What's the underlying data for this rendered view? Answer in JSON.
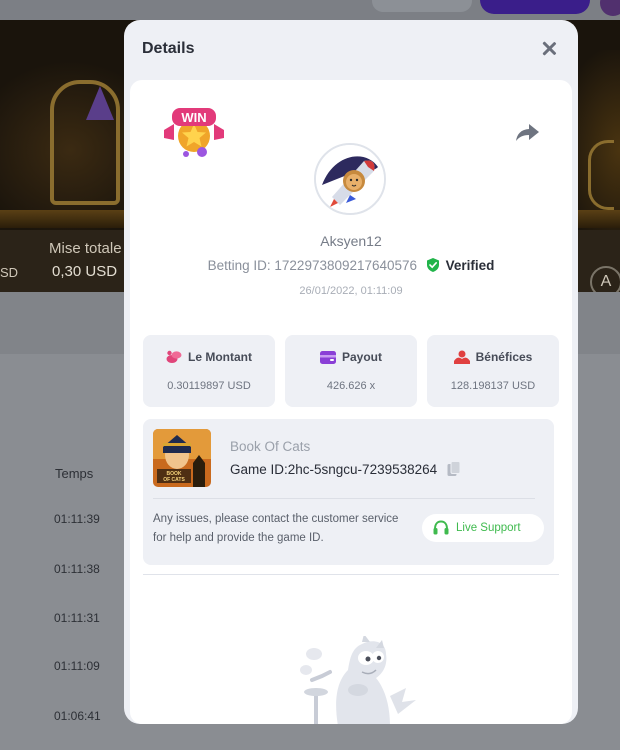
{
  "background": {
    "bet_label": "Mise totale",
    "bet_value": "0,30 USD",
    "left_currency": "SD",
    "auto_button": "A",
    "history_column_header": "Temps",
    "history_times": [
      "01:11:39",
      "01:11:38",
      "01:11:31",
      "01:11:09",
      "01:06:41"
    ]
  },
  "modal": {
    "title": "Details",
    "close_icon": "close-icon",
    "share_icon": "share-icon",
    "badge_text": "WIN",
    "username": "Aksyen12",
    "betting_id_label": "Betting ID:",
    "betting_id": "1722973809217640576",
    "verified_label": "Verified",
    "timestamp": "26/01/2022, 01:11:09",
    "stats": [
      {
        "label": "Le Montant",
        "value": "0.30119897 USD",
        "icon": "coins-icon",
        "color": "#e0457a"
      },
      {
        "label": "Payout",
        "value": "426.626 x",
        "icon": "wallet-icon",
        "color": "#8a3fd6"
      },
      {
        "label": "Bénéfices",
        "value": "128.198137 USD",
        "icon": "profit-icon",
        "color": "#e04040"
      }
    ],
    "game": {
      "name": "Book Of Cats",
      "id_label": "Game ID:",
      "id": "2hc-5sngcu-7239538264",
      "thumb_text": "BOOK OF CATS"
    },
    "issue_text": "Any issues, please contact the customer service for help and provide the game ID.",
    "live_support_label": "Live Support"
  },
  "colors": {
    "accent_green": "#3fba4e",
    "verified_green": "#21b44a",
    "modal_bg": "#eef0f5"
  }
}
